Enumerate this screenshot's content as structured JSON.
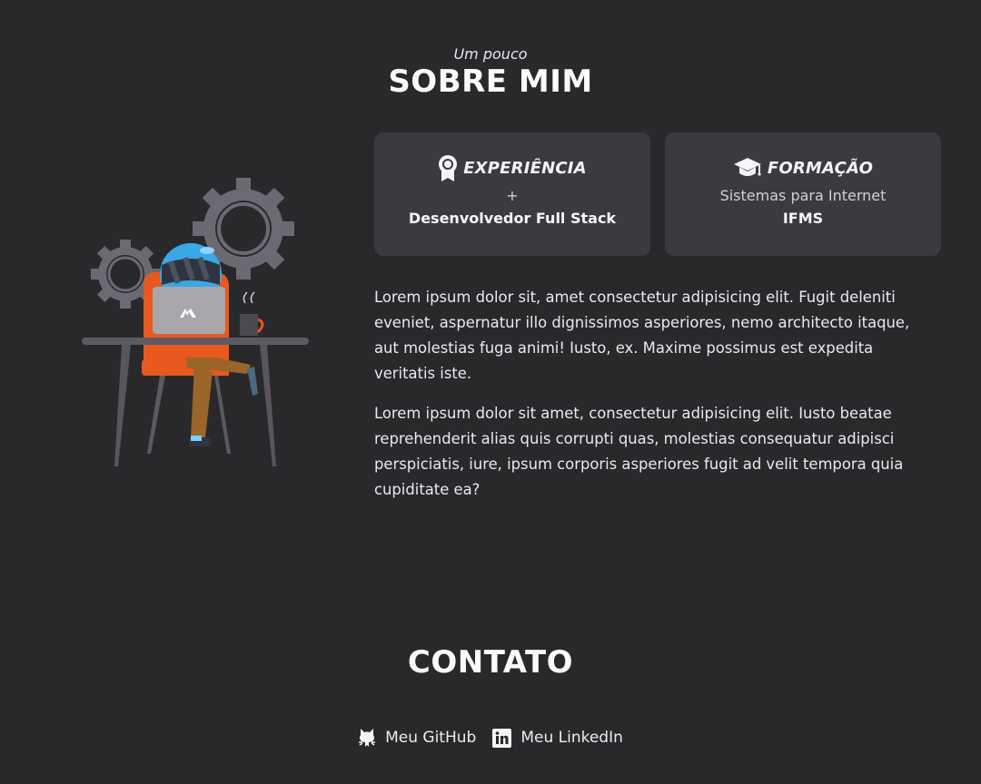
{
  "about": {
    "kicker": "Um pouco",
    "title": "SOBRE MIM"
  },
  "cards": [
    {
      "icon": "award-ribbon-icon",
      "title": "EXPERIÊNCIA",
      "line": "+",
      "strong": "Desenvolvedor Full Stack"
    },
    {
      "icon": "graduation-cap-icon",
      "title": "FORMAÇÃO",
      "line": "Sistemas para Internet",
      "strong": "IFMS"
    }
  ],
  "paragraphs": [
    "Lorem ipsum dolor sit, amet consectetur adipisicing elit. Fugit deleniti eveniet, aspernatur illo dignissimos asperiores, nemo architecto itaque, aut molestias fuga animi! Iusto, ex. Maxime possimus est expedita veritatis iste.",
    "Lorem ipsum dolor sit amet, consectetur adipisicing elit. Iusto beatae reprehenderit alias quis corrupti quas, molestias consequatur adipisci perspiciatis, iure, ipsum corporis asperiores fugit ad velit tempora quia cupiditate ea?"
  ],
  "contact": {
    "title": "CONTATO",
    "links": [
      {
        "icon": "github-icon",
        "label": "Meu GitHub"
      },
      {
        "icon": "linkedin-icon",
        "label": "Meu LinkedIn"
      }
    ]
  },
  "colors": {
    "background": "#29292c",
    "card": "#3b3a40",
    "text": "#ececef",
    "helmet": "#3aa7e6",
    "chair": "#e8581f",
    "gear": "#6b6a72"
  }
}
